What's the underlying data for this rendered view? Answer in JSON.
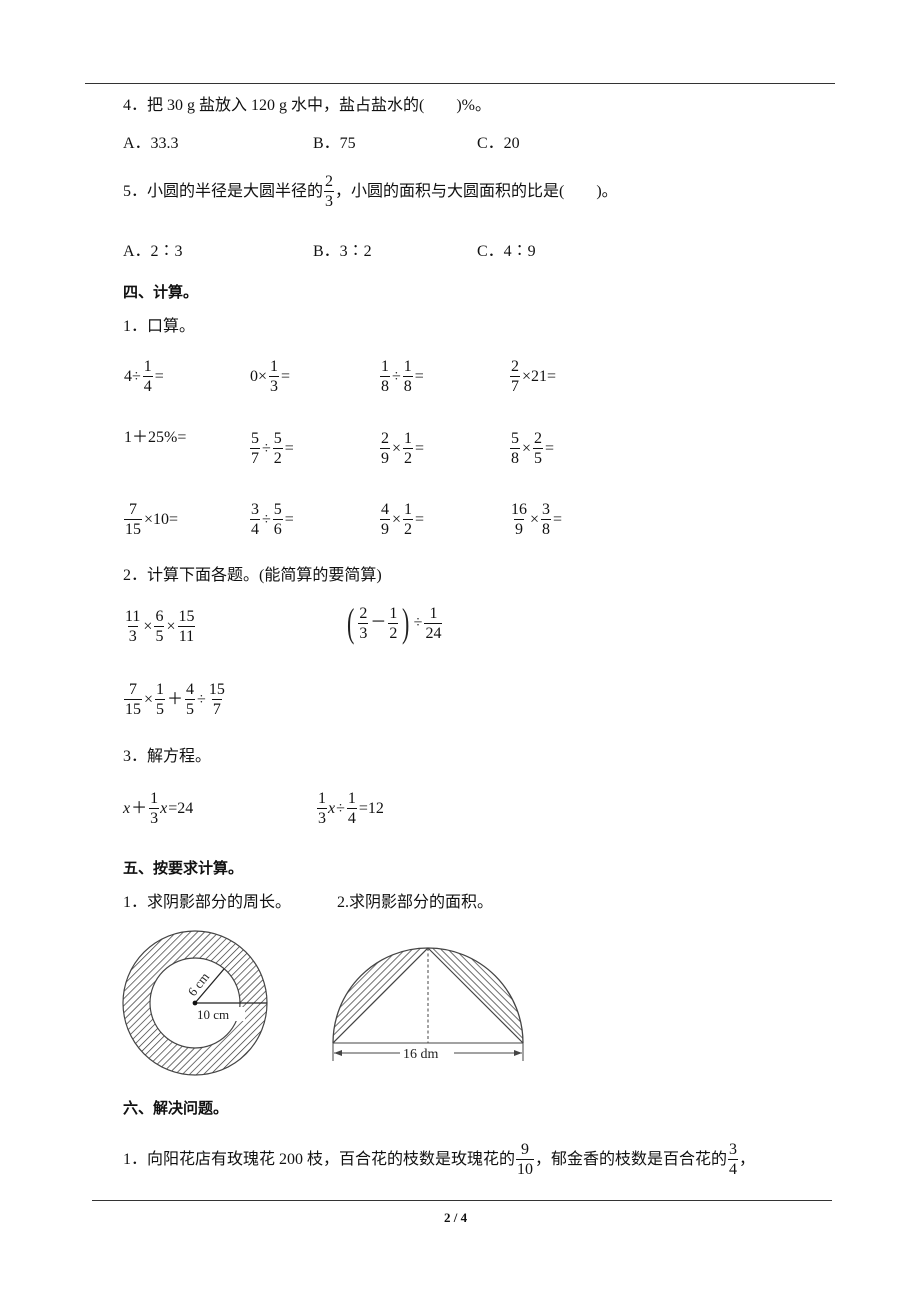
{
  "page": {
    "number": "2 / 4"
  },
  "q4": {
    "stem": "4．把 30 g 盐放入 120 g 水中，盐占盐水的(　　)%。",
    "options": [
      "A．33.3",
      "B．75",
      "C．20"
    ]
  },
  "q5": {
    "stem_before": "5．小圆的半径是大圆半径的",
    "frac_num": "2",
    "frac_den": "3",
    "stem_after": "，小圆的面积与大圆面积的比是(　　)。",
    "options": [
      "A．2∶3",
      "B．3∶2",
      "C．4∶9"
    ]
  },
  "section4": {
    "title": "四、计算。",
    "oral": {
      "label": "1．口算。",
      "rows": [
        [
          {
            "parts": [
              {
                "t": "4÷"
              },
              {
                "n": "1",
                "d": "4"
              },
              {
                "t": "="
              }
            ]
          },
          {
            "parts": [
              {
                "t": "0×"
              },
              {
                "n": "1",
                "d": "3"
              },
              {
                "t": "="
              }
            ]
          },
          {
            "parts": [
              {
                "n": "1",
                "d": "8"
              },
              {
                "t": "÷"
              },
              {
                "n": "1",
                "d": "8"
              },
              {
                "t": "="
              }
            ]
          },
          {
            "parts": [
              {
                "n": "2",
                "d": "7"
              },
              {
                "t": "×21="
              }
            ]
          }
        ],
        [
          {
            "parts": [
              {
                "t": "1＋25%="
              }
            ]
          },
          {
            "parts": [
              {
                "n": "5",
                "d": "7"
              },
              {
                "t": "÷"
              },
              {
                "n": "5",
                "d": "2"
              },
              {
                "t": "="
              }
            ]
          },
          {
            "parts": [
              {
                "n": "2",
                "d": "9"
              },
              {
                "t": "×"
              },
              {
                "n": "1",
                "d": "2"
              },
              {
                "t": "="
              }
            ]
          },
          {
            "parts": [
              {
                "n": "5",
                "d": "8"
              },
              {
                "t": "×"
              },
              {
                "n": "2",
                "d": "5"
              },
              {
                "t": "="
              }
            ]
          }
        ],
        [
          {
            "parts": [
              {
                "n": "7",
                "d": "15"
              },
              {
                "t": "×10="
              }
            ]
          },
          {
            "parts": [
              {
                "n": "3",
                "d": "4"
              },
              {
                "t": "÷"
              },
              {
                "n": "5",
                "d": "6"
              },
              {
                "t": "="
              }
            ]
          },
          {
            "parts": [
              {
                "n": "4",
                "d": "9"
              },
              {
                "t": "×"
              },
              {
                "n": "1",
                "d": "2"
              },
              {
                "t": "="
              }
            ]
          },
          {
            "parts": [
              {
                "n": "16",
                "d": "9"
              },
              {
                "t": "×"
              },
              {
                "n": "3",
                "d": "8"
              },
              {
                "t": "="
              }
            ]
          }
        ]
      ]
    },
    "compute": {
      "label": "2．计算下面各题。(能简算的要简算)",
      "expr1": [
        {
          "n": "11",
          "d": "3"
        },
        {
          "t": "×"
        },
        {
          "n": "6",
          "d": "5"
        },
        {
          "t": "×"
        },
        {
          "n": "15",
          "d": "11"
        }
      ],
      "expr2": [
        {
          "p": "("
        },
        {
          "n": "2",
          "d": "3"
        },
        {
          "t": "－"
        },
        {
          "n": "1",
          "d": "2"
        },
        {
          "p": ")"
        },
        {
          "t": "÷"
        },
        {
          "n": "1",
          "d": "24"
        }
      ],
      "expr3": [
        {
          "n": "7",
          "d": "15"
        },
        {
          "t": "×"
        },
        {
          "n": "1",
          "d": "5"
        },
        {
          "t": "＋"
        },
        {
          "n": "4",
          "d": "5"
        },
        {
          "t": "÷"
        },
        {
          "n": "15",
          "d": "7"
        }
      ]
    },
    "equations": {
      "label": "3．解方程。",
      "eq1": [
        {
          "v": "x"
        },
        {
          "t": "＋"
        },
        {
          "n": "1",
          "d": "3"
        },
        {
          "v": "x"
        },
        {
          "t": "=24"
        }
      ],
      "eq2": [
        {
          "n": "1",
          "d": "3"
        },
        {
          "v": "x"
        },
        {
          "t": "÷"
        },
        {
          "n": "1",
          "d": "4"
        },
        {
          "t": "=12"
        }
      ]
    }
  },
  "section5": {
    "title": "五、按要求计算。",
    "q1_label": "1．求阴影部分的周长。",
    "q2_label": "2.求阴影部分的面积。",
    "fig1": {
      "inner_radius_label": "6 cm",
      "outer_radius_label": "10 cm"
    },
    "fig2": {
      "diameter_label": "16 dm"
    }
  },
  "section6": {
    "title": "六、解决问题。",
    "q1_a": "1．向阳花店有玫瑰花 200 枝，百合花的枝数是玫瑰花的",
    "q1_f1_num": "9",
    "q1_f1_den": "10",
    "q1_b": "，郁金香的枝数是百合花的",
    "q1_f2_num": "3",
    "q1_f2_den": "4",
    "q1_c": "，"
  }
}
